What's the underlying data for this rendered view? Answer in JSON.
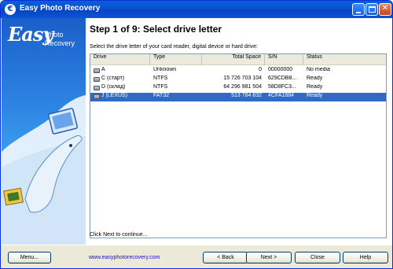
{
  "window": {
    "title": "Easy Photo Recovery"
  },
  "sidebar": {
    "logo_easy": "Easy",
    "logo_line1": "Photo",
    "logo_line2": "Recovery"
  },
  "content": {
    "step_title": "Step 1 of 9: Select drive letter",
    "instruction": "Select the drive letter of your card reader, digital device or hard drive:",
    "continue_text": "Click Next to continue..."
  },
  "table": {
    "headers": [
      "Drive",
      "Type",
      "Total Space",
      "S/N",
      "Status"
    ],
    "rows": [
      {
        "drive": "A",
        "type": "Unknown",
        "total": "0",
        "sn": "00000000",
        "status": "No media",
        "selected": false
      },
      {
        "drive": "C (старт)",
        "type": "NTFS",
        "total": "15 726 703 104",
        "sn": "629CDB8...",
        "status": "Ready",
        "selected": false
      },
      {
        "drive": "D (склад)",
        "type": "NTFS",
        "total": "64 296 981 504",
        "sn": "58D8FC3...",
        "status": "Ready",
        "selected": false
      },
      {
        "drive": "J (LEXUS)",
        "type": "FAT32",
        "total": "513 784 832",
        "sn": "4CFA1884",
        "status": "Ready",
        "selected": true
      }
    ]
  },
  "footer": {
    "menu_label": "Menu...",
    "website": "www.easyphotorecovery.com",
    "back_label": "< Back",
    "next_label": "Next >",
    "close_label": "Close",
    "help_label": "Help"
  },
  "colors": {
    "selection": "#316ac5",
    "titlebar": "#0b4fd0",
    "link": "#1515c8"
  }
}
